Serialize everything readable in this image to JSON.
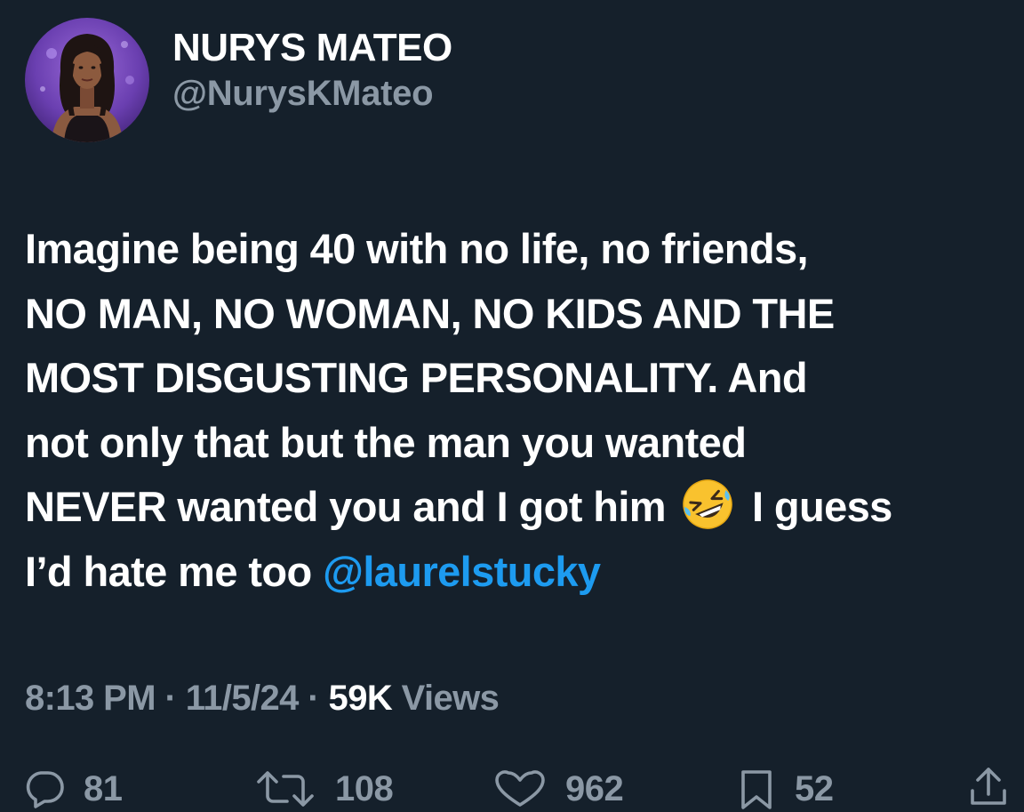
{
  "author": {
    "display_name": "NURYS MATEO",
    "handle": "@NurysKMateo",
    "avatar_icon": "profile-photo"
  },
  "tweet": {
    "lines": [
      "Imagine being 40 with no life, no friends,",
      "NO MAN, NO WOMAN, NO KIDS AND THE",
      "MOST DISGUSTING PERSONALITY. And",
      "not only that but the man you wanted"
    ],
    "line5_before_emoji": "NEVER wanted you and I got him",
    "emoji_icon": "rolling-on-floor-laughing-emoji",
    "line5_after_emoji": "I guess",
    "line6_text": "I’d hate me too ",
    "mention": "@laurelstucky"
  },
  "meta": {
    "time": "8:13 PM",
    "separator": " · ",
    "date": "11/5/24",
    "views_count": "59K",
    "views_label": " Views"
  },
  "actions": {
    "replies": "81",
    "retweets": "108",
    "likes": "962",
    "bookmarks": "52"
  },
  "colors": {
    "background": "#15202b",
    "text": "#ffffff",
    "secondary": "#8b98a5",
    "link": "#1d9bf0"
  }
}
